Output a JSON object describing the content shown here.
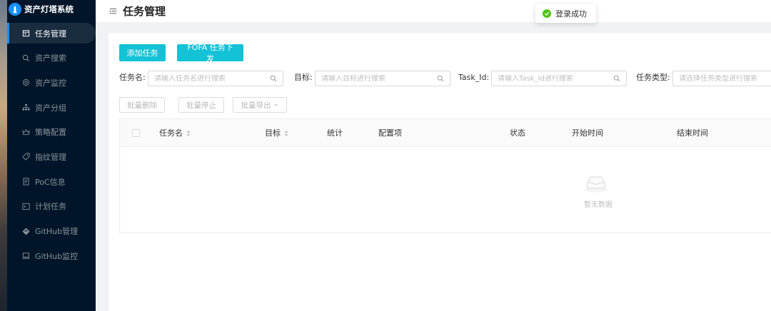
{
  "app": {
    "title": "资产灯塔系统"
  },
  "sidebar": {
    "items": [
      {
        "label": "任务管理",
        "icon": "calendar-icon",
        "active": true
      },
      {
        "label": "资产搜索",
        "icon": "search-icon",
        "active": false
      },
      {
        "label": "资产监控",
        "icon": "eye-icon",
        "active": false
      },
      {
        "label": "资产分组",
        "icon": "sitemap-icon",
        "active": false
      },
      {
        "label": "策略配置",
        "icon": "crown-icon",
        "active": false
      },
      {
        "label": "指纹管理",
        "icon": "tag-icon",
        "active": false
      },
      {
        "label": "PoC信息",
        "icon": "document-icon",
        "active": false
      },
      {
        "label": "计划任务",
        "icon": "terminal-icon",
        "active": false
      },
      {
        "label": "GitHub管理",
        "icon": "diamond-icon",
        "active": false
      },
      {
        "label": "GitHub监控",
        "icon": "monitor-icon",
        "active": false
      }
    ]
  },
  "header": {
    "title": "任务管理"
  },
  "toast": {
    "message": "登录成功"
  },
  "toolbar": {
    "add_task": "添加任务",
    "fofa_task": "FOFA 任务下发",
    "batch_delete": "批量删除",
    "batch_stop": "批量停止",
    "batch_export": "批量导出"
  },
  "filters": {
    "task_name": {
      "label": "任务名:",
      "placeholder": "请输入任务名进行搜索"
    },
    "target": {
      "label": "目标:",
      "placeholder": "请输入目标进行搜索"
    },
    "task_id": {
      "label": "Task_Id:",
      "placeholder": "请输入Task_Id进行搜索"
    },
    "task_type": {
      "label": "任务类型:",
      "placeholder": "请选择任务类型进行搜索"
    }
  },
  "table": {
    "columns": {
      "name": "任务名",
      "target": "目标",
      "stats": "统计",
      "config": "配置项",
      "status": "状态",
      "start_time": "开始时间",
      "end_time": "结束时间"
    },
    "empty_text": "暂无数据"
  },
  "colors": {
    "sidebar_bg": "#001529",
    "primary": "#13c2d6",
    "accent": "#1890ff",
    "success": "#52c41a"
  }
}
